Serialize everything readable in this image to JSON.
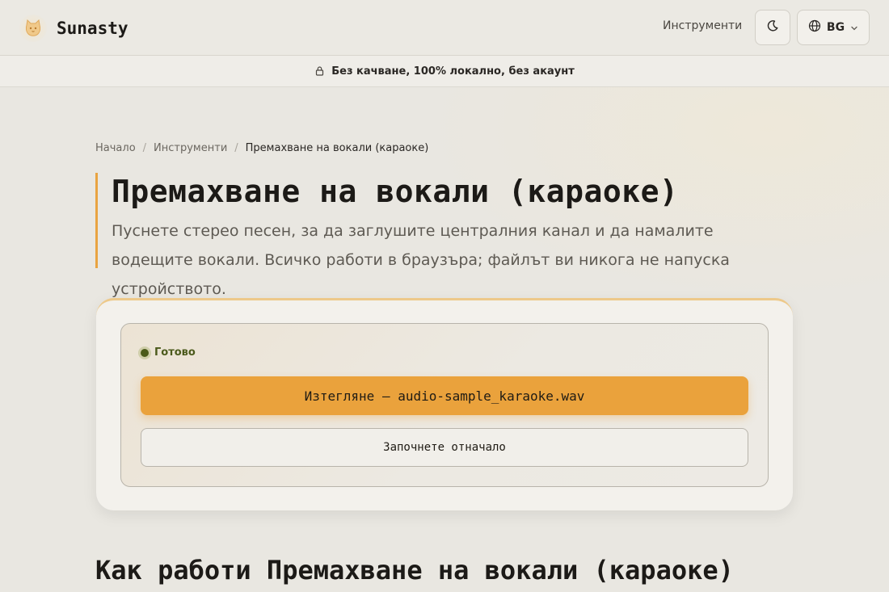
{
  "header": {
    "brand_name": "Sunasty",
    "nav_tools": "Инструменти",
    "language": "BG"
  },
  "privacy_bar": {
    "text": "Без качване, 100% локално, без акаунт"
  },
  "breadcrumb": {
    "home": "Начало",
    "tools": "Инструменти",
    "current": "Премахване на вокали (караоке)"
  },
  "hero": {
    "title": "Премахване на вокали (караоке)",
    "description": "Пуснете стерео песен, за да заглушите централния канал и да намалите водещите вокали. Всичко работи в браузъра; файлът ви никога не напуска устройството."
  },
  "tool": {
    "status": "Готово",
    "download_label": "Изтегляне — audio-sample_karaoke.wav",
    "restart_label": "Започнете отначало"
  },
  "section": {
    "heading": "Как работи Премахване на вокали (караоке)"
  },
  "colors": {
    "accent": "#eaa23c",
    "status_green": "#4b5a1c"
  },
  "icons": {
    "logo": "cat-logo-icon",
    "theme": "moon-icon",
    "language": "globe-icon",
    "dropdown": "chevron-down-icon",
    "privacy": "lock-icon"
  }
}
